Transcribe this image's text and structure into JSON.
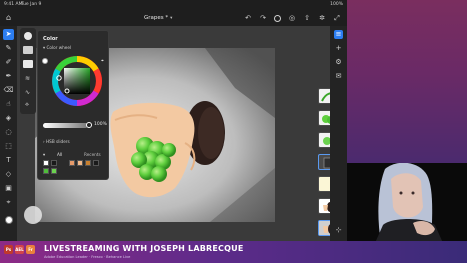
{
  "status_bar": {
    "time": "9:41 AM",
    "date": "Tue Jan 9",
    "battery": "100%"
  },
  "document": {
    "title": "Grapes *"
  },
  "topbar": {
    "home_icon": "home-icon",
    "icons": [
      "undo-icon",
      "redo-icon",
      "help-icon",
      "view-icon",
      "share-icon",
      "settings-icon",
      "fullscreen-icon"
    ]
  },
  "color_panel": {
    "title": "Color",
    "section": "Color wheel",
    "opacity": "100%",
    "opacity_value": 1.0,
    "hsb_sliders": "HSB sliders",
    "tab_all": "All",
    "tab_recents": "Recents",
    "swatches": [
      "#ffffff",
      "#1a1a1a",
      "#e59a6a",
      "#f2b98a",
      "#c8802f",
      "#1a1a1a",
      "#4fbd3a",
      "#6bd24f"
    ]
  },
  "banner": {
    "logos": [
      {
        "text": "Ps",
        "color": "#c0392b"
      },
      {
        "text": "AEL",
        "color": "#d1444b"
      },
      {
        "text": "Fr",
        "color": "#e8803c"
      }
    ],
    "headline": "LIVESTREAMING WITH JOSEPH LABRECQUE",
    "subtitle": "Adobe Education Leader · Fresco · Behance Live"
  }
}
